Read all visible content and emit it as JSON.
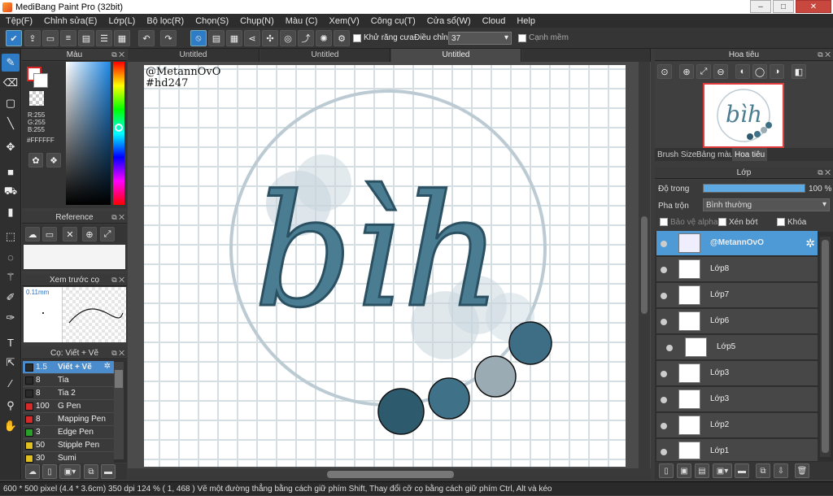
{
  "window": {
    "title": "MediBang Paint Pro (32bit)"
  },
  "menu": [
    "Tệp(F)",
    "Chỉnh sửa(E)",
    "Lớp(L)",
    "Bộ lọc(R)",
    "Chọn(S)",
    "Chụp(N)",
    "Màu (C)",
    "Xem(V)",
    "Công cụ(T)",
    "Cửa sổ(W)",
    "Cloud",
    "Help"
  ],
  "toolbar": {
    "antialias_label": "Khử răng cưa",
    "adjust_label": "Điều chỉnh",
    "adjust_value": "37",
    "edge_label": "Cạnh mềm"
  },
  "tabs": [
    "Untitled",
    "Untitled",
    "Untitled"
  ],
  "color_panel": {
    "title": "Màu",
    "r": "R:255",
    "g": "G:255",
    "b": "B:255",
    "hex": "#FFFFFF"
  },
  "reference_panel": {
    "title": "Reference"
  },
  "brush_preview": {
    "title": "Xem trước cọ",
    "size": "0.11mm"
  },
  "brush_panel": {
    "title": "Cọ: Viết + Vẽ",
    "brushes": [
      {
        "size": "1.5",
        "name": "Viết + Vẽ",
        "color": "#2a2a2a",
        "selected": true
      },
      {
        "size": "8",
        "name": "Tia",
        "color": "#2a2a2a"
      },
      {
        "size": "8",
        "name": "Tia 2",
        "color": "#2a2a2a"
      },
      {
        "size": "100",
        "name": "G Pen",
        "color": "#d42a2a"
      },
      {
        "size": "8",
        "name": "Mapping Pen",
        "color": "#d42a2a"
      },
      {
        "size": "3",
        "name": "Edge Pen",
        "color": "#2aa02a"
      },
      {
        "size": "50",
        "name": "Stipple Pen",
        "color": "#e0c020"
      },
      {
        "size": "30",
        "name": "Sumi",
        "color": "#e0c020"
      }
    ]
  },
  "canvas": {
    "watermark_line1": "@MetannOvO",
    "watermark_line2": "#hd247",
    "lettering": "bìh"
  },
  "navigator": {
    "title": "Hoa tiêu",
    "tabs": [
      "Brush Size",
      "Bảng màu",
      "Hoa tiêu"
    ]
  },
  "layer_panel": {
    "title": "Lớp",
    "opacity_label": "Độ trong",
    "opacity_value": "100 %",
    "opacity": 1.0,
    "blend_label": "Pha trộn",
    "blend_value": "Bình thường",
    "protect_alpha": "Bảo vệ alpha",
    "clipping": "Xén bớt",
    "lock": "Khóa",
    "layers": [
      "@MetannOvO",
      "Lớp8",
      "Lớp7",
      "Lớp6",
      "Lớp5",
      "Lớp3",
      "Lớp3",
      "Lớp2",
      "Lớp1"
    ]
  },
  "status": "600 * 500 pixel  (4.4 * 3.6cm)  350 dpi  124 %  ( 1, 468 )  Vẽ một đường thẳng bằng cách giữ phím Shift, Thay đổi cỡ cọ bằng cách giữ phím Ctrl, Alt và kéo",
  "colors": {
    "accent": "#2f7cc6",
    "ink": "#3f6d80",
    "dots": "#2e5a6e"
  }
}
